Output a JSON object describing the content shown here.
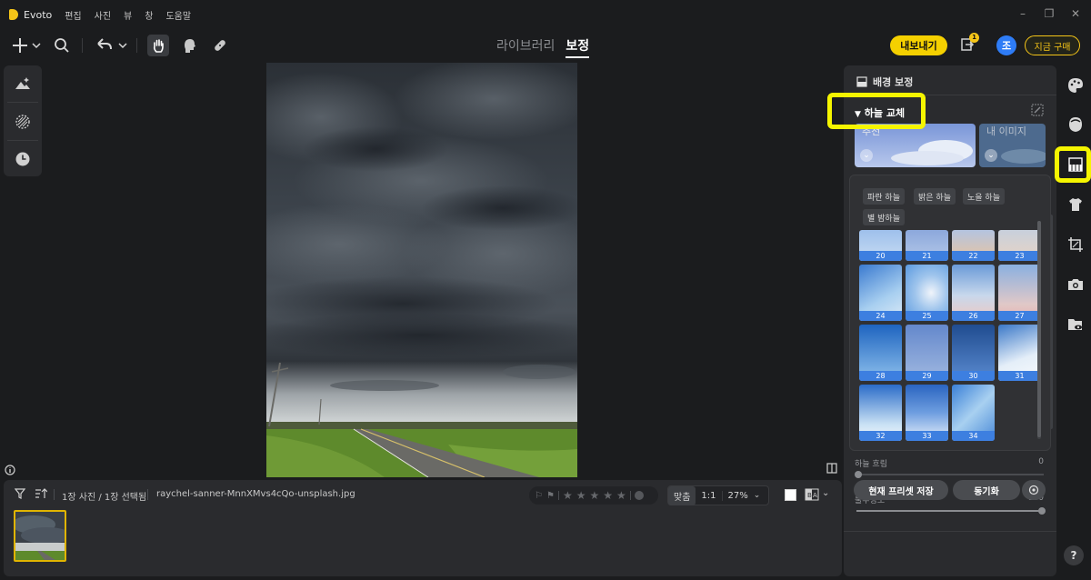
{
  "app": {
    "name": "Evoto",
    "menu": [
      "편집",
      "사진",
      "뷰",
      "창",
      "도움말"
    ]
  },
  "toolbar": {
    "modes": [
      "라이브러리",
      "보정"
    ],
    "active_mode": "보정",
    "export_label": "내보내기",
    "export_badge": "1",
    "avatar_initial": "조",
    "buy_label": "지금 구매"
  },
  "filmstrip": {
    "count_text": "1장 사진 / 1장 선택됨",
    "filename": "raychel-sanner-MnnXMvs4cQo-unsplash.jpg",
    "zoom_fit": "맞춤",
    "zoom_one": "1:1",
    "zoom_pct": "27%"
  },
  "panel": {
    "section_title": "배경 보정",
    "sky_header": "하늘 교체",
    "preset_left": "추천",
    "preset_right": "내 이미지",
    "chips": [
      "파란 하늘",
      "밝은 하늘",
      "노을 하늘",
      "별 밤하늘"
    ],
    "thumbs": [
      {
        "num": "20"
      },
      {
        "num": "21"
      },
      {
        "num": "22"
      },
      {
        "num": "23"
      },
      {
        "num": "24"
      },
      {
        "num": "25"
      },
      {
        "num": "26"
      },
      {
        "num": "27"
      },
      {
        "num": "28"
      },
      {
        "num": "29"
      },
      {
        "num": "30"
      },
      {
        "num": "31"
      },
      {
        "num": "32"
      },
      {
        "num": "33"
      },
      {
        "num": "34"
      }
    ],
    "blur_label": "하늘 흐림",
    "blur_value": "0",
    "opacity_label": "불투명도",
    "opacity_value": "100",
    "save_preset": "현재 프리셋 저장",
    "sync": "동기화"
  },
  "colors": {
    "accent": "#f5d000",
    "highlight": "#f5f500",
    "avatar": "#2e7cf6"
  }
}
